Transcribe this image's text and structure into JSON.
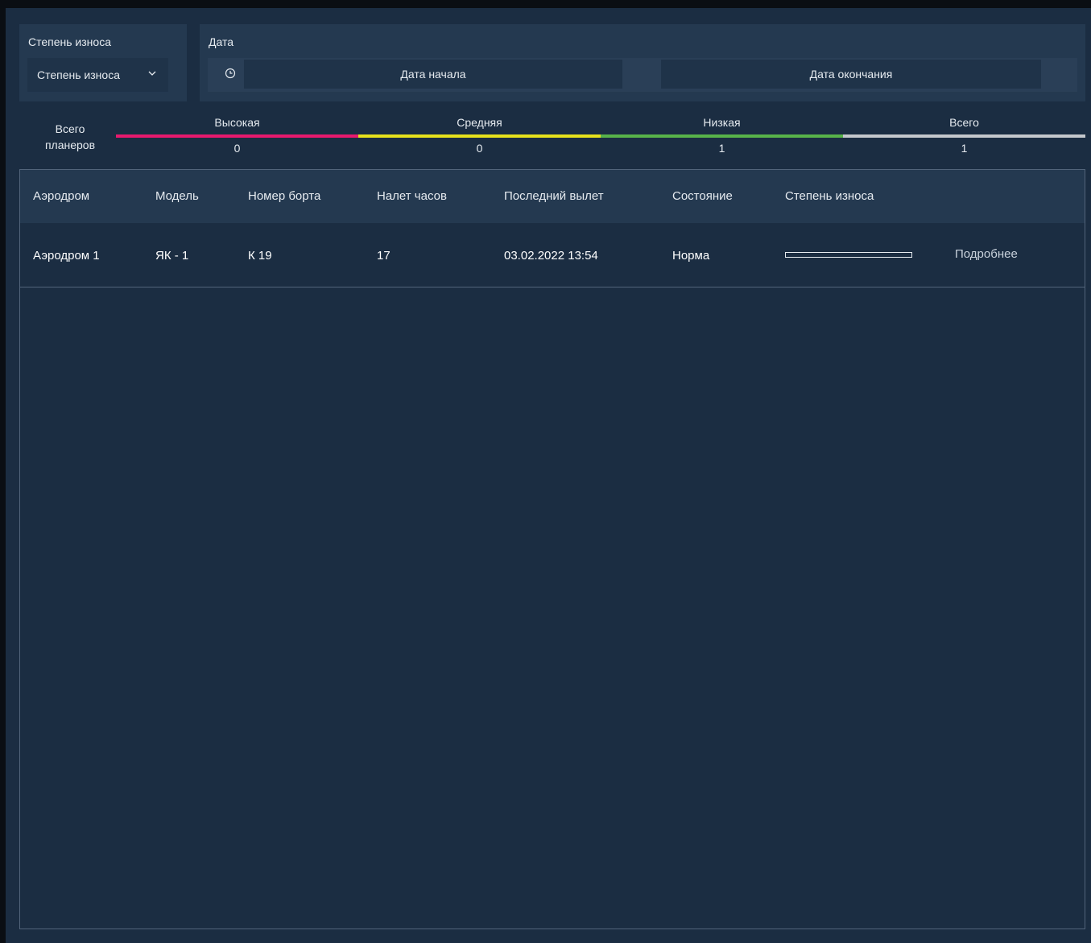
{
  "filters": {
    "wear": {
      "label": "Степень износа",
      "selected": "Степень износа"
    },
    "date": {
      "label": "Дата",
      "start_placeholder": "Дата начала",
      "end_placeholder": "Дата окончания"
    }
  },
  "stats": {
    "total_label": "Всего планеров",
    "items": [
      {
        "label": "Высокая",
        "value": "0",
        "color": "#e8196e"
      },
      {
        "label": "Средняя",
        "value": "0",
        "color": "#e6e11c"
      },
      {
        "label": "Низкая",
        "value": "1",
        "color": "#58b34a"
      },
      {
        "label": "Всего",
        "value": "1",
        "color": "#c4c8cc"
      }
    ]
  },
  "table": {
    "headers": [
      "Аэродром",
      "Модель",
      "Номер борта",
      "Налет часов",
      "Последний вылет",
      "Состояние",
      "Степень износа"
    ],
    "rows": [
      {
        "airfield": "Аэродром 1",
        "model": "ЯК - 1",
        "board": "К 19",
        "hours": "17",
        "last_flight": "03.02.2022 13:54",
        "state": "Норма",
        "wear_level": 0,
        "details": "Подробнее"
      }
    ]
  },
  "colors": {
    "background": "#1b2d42",
    "panel": "#243950",
    "input": "#1f3349"
  }
}
